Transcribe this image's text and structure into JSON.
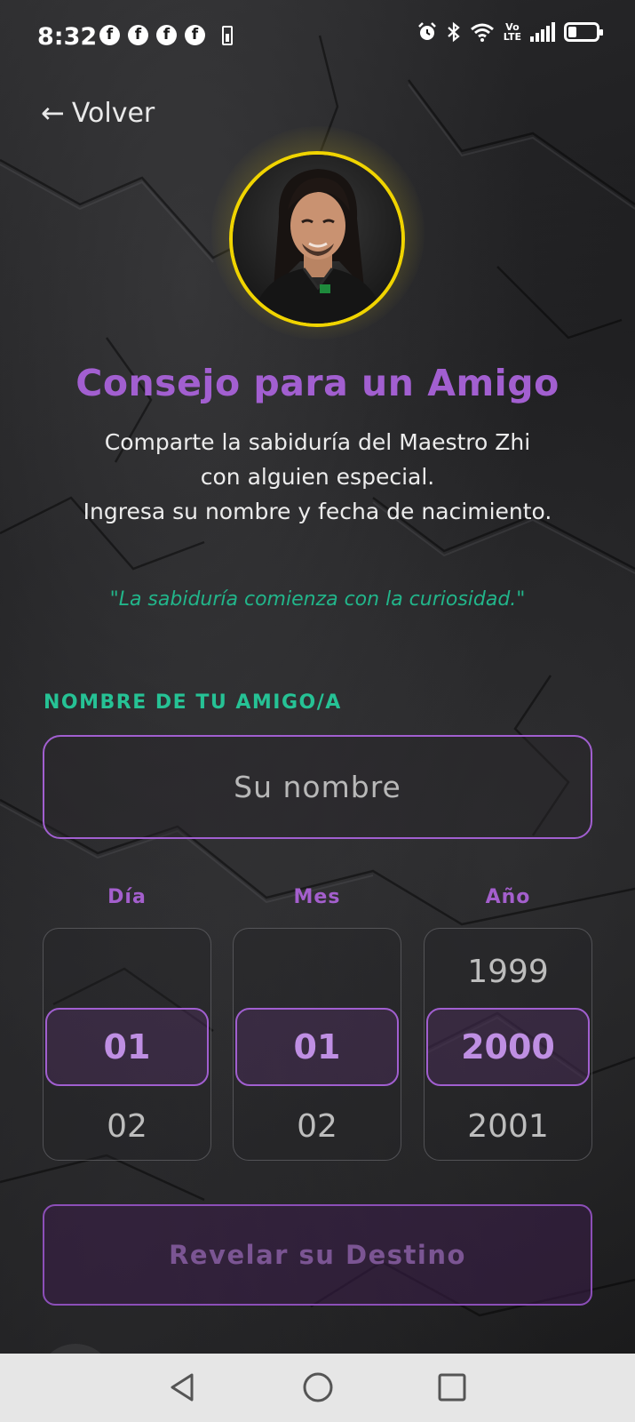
{
  "status_bar": {
    "time": "8:32",
    "notification_icons": [
      "facebook-icon",
      "facebook-icon",
      "facebook-icon",
      "facebook-icon"
    ],
    "volte_top": "Vo",
    "volte_bottom": "LTE"
  },
  "header": {
    "back_arrow": "←",
    "back_label": "Volver"
  },
  "intro": {
    "title": "Consejo para un Amigo",
    "subtitle_line1": "Comparte la sabiduría del Maestro Zhi",
    "subtitle_line2": "con alguien especial.",
    "subtitle_line3": "Ingresa su nombre y fecha de nacimiento.",
    "quote": "\"La sabiduría comienza con la curiosidad.\""
  },
  "form": {
    "name_label": "NOMBRE DE TU AMIGO/A",
    "name_placeholder": "Su nombre",
    "name_value": "",
    "day": {
      "label": "Día",
      "prev": "",
      "selected": "01",
      "next": "02"
    },
    "month": {
      "label": "Mes",
      "prev": "",
      "selected": "01",
      "next": "02"
    },
    "year": {
      "label": "Año",
      "prev": "1999",
      "selected": "2000",
      "next": "2001"
    },
    "submit_label": "Revelar su Destino"
  },
  "colors": {
    "accent_purple": "#a25fd0",
    "accent_green": "#26c295",
    "avatar_ring": "#f0d400"
  }
}
